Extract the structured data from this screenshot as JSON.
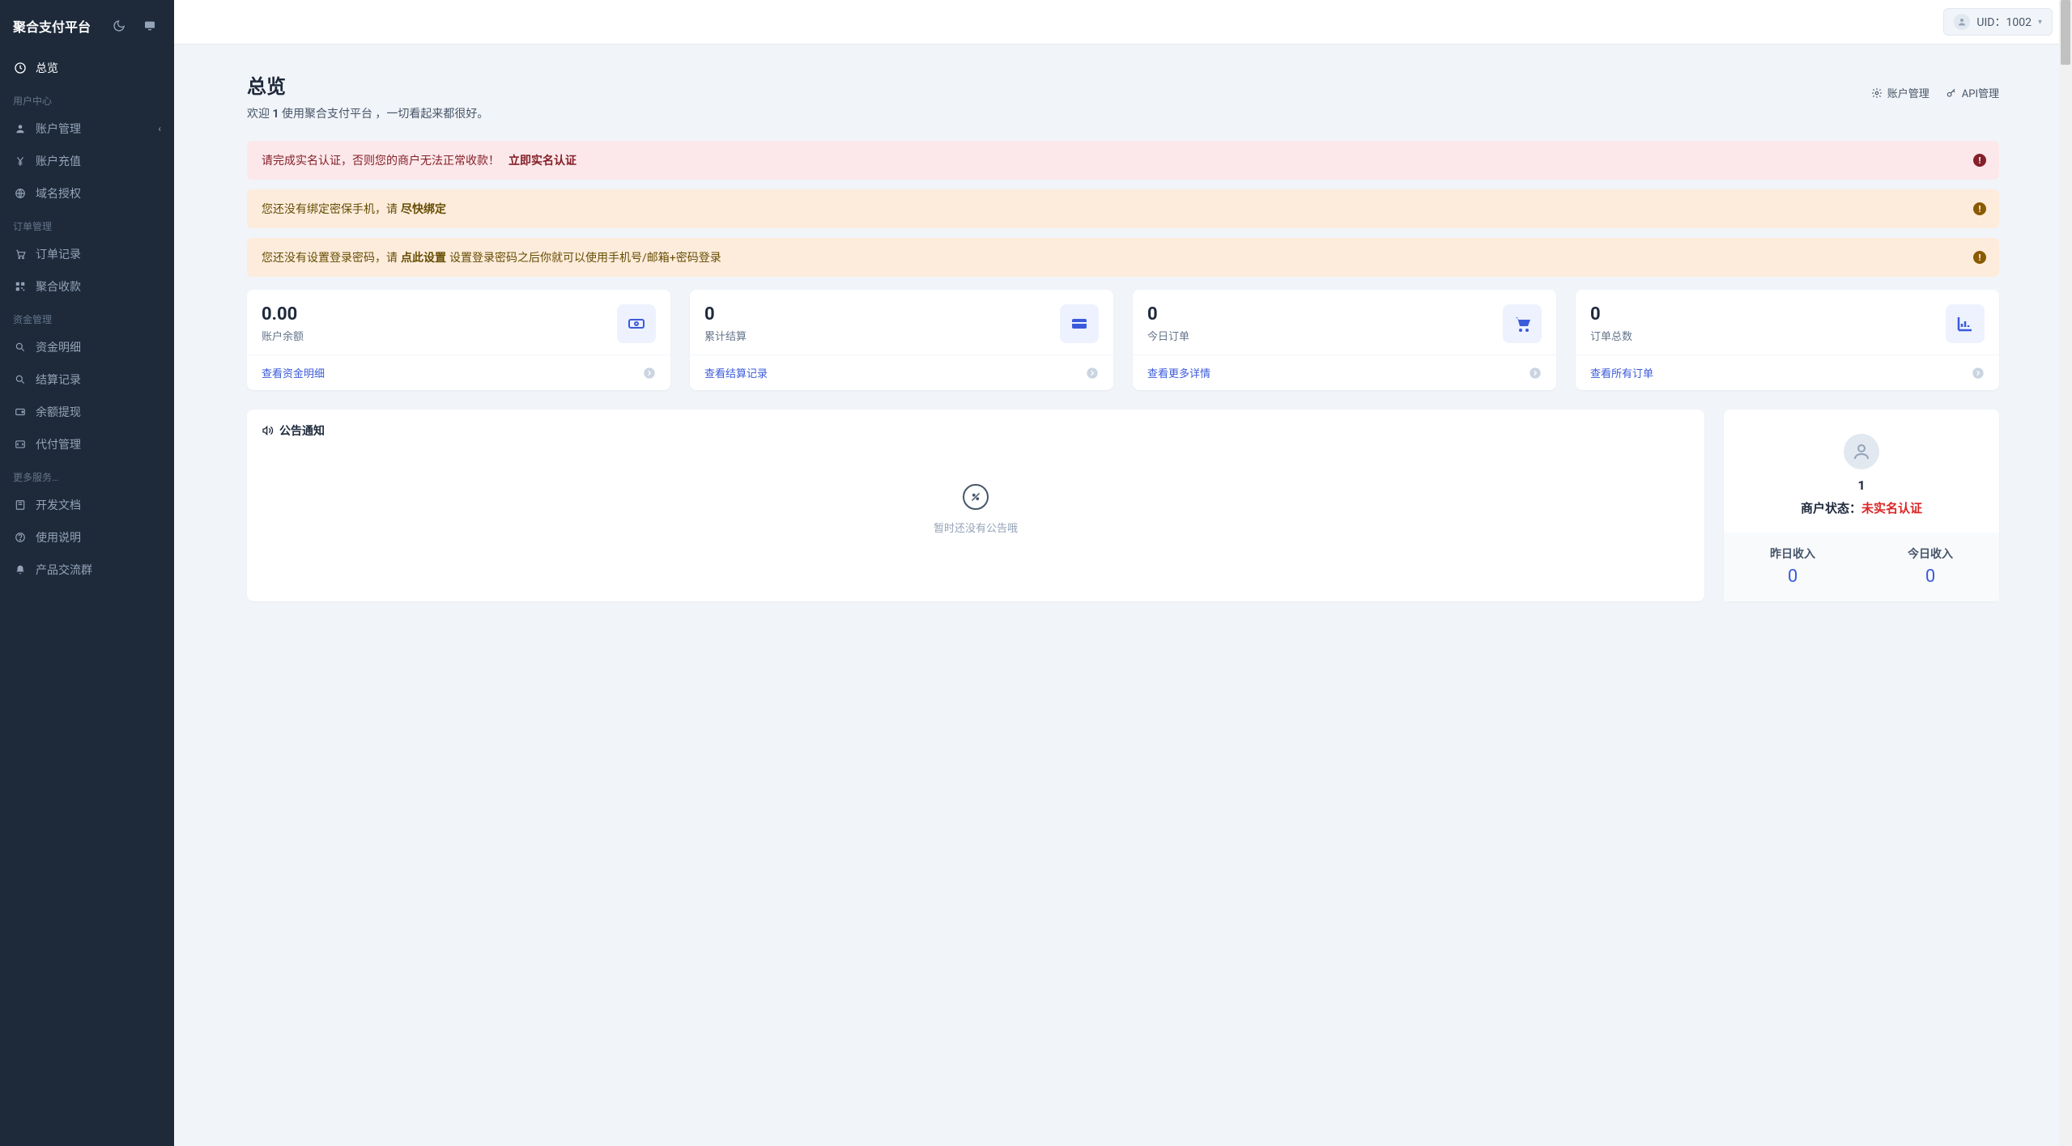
{
  "app": {
    "name": "聚合支付平台"
  },
  "topbar": {
    "uid_label": "UID：1002"
  },
  "sidebar": {
    "overview": "总览",
    "sections": {
      "user_center": "用户中心",
      "order_mgmt": "订单管理",
      "fund_mgmt": "资金管理",
      "more": "更多服务…"
    },
    "items": {
      "account_mgmt": "账户管理",
      "account_recharge": "账户充值",
      "domain_auth": "域名授权",
      "order_records": "订单记录",
      "aggregate_pay": "聚合收款",
      "fund_detail": "资金明细",
      "settle_records": "结算记录",
      "balance_withdraw": "余额提现",
      "payout_mgmt": "代付管理",
      "dev_docs": "开发文档",
      "usage_guide": "使用说明",
      "product_group": "产品交流群"
    }
  },
  "page": {
    "title": "总览",
    "welcome_prefix": "欢迎 ",
    "welcome_name": "1",
    "welcome_suffix": " 使用聚合支付平台 ，一切看起来都很好。",
    "actions": {
      "account": "账户管理",
      "api": "API管理"
    }
  },
  "alerts": {
    "a1_text": "请完成实名认证，否则您的商户无法正常收款！",
    "a1_link": "立即实名认证",
    "a2_text": "您还没有绑定密保手机，请 ",
    "a2_link": "尽快绑定",
    "a3_text": "您还没有设置登录密码，请 ",
    "a3_link": "点此设置",
    "a3_suffix": " 设置登录密码之后你就可以使用手机号/邮箱+密码登录"
  },
  "stats": {
    "balance": {
      "value": "0.00",
      "label": "账户余额",
      "link": "查看资金明细"
    },
    "settled": {
      "value": "0",
      "label": "累计结算",
      "link": "查看结算记录"
    },
    "today_orders": {
      "value": "0",
      "label": "今日订单",
      "link": "查看更多详情"
    },
    "total_orders": {
      "value": "0",
      "label": "订单总数",
      "link": "查看所有订单"
    }
  },
  "notice": {
    "title": "公告通知",
    "empty": "暂时还没有公告哦"
  },
  "merchant": {
    "name": "1",
    "status_label": "商户状态：",
    "status_value": "未实名认证",
    "yesterday_label": "昨日收入",
    "yesterday_value": "0",
    "today_label": "今日收入",
    "today_value": "0"
  }
}
